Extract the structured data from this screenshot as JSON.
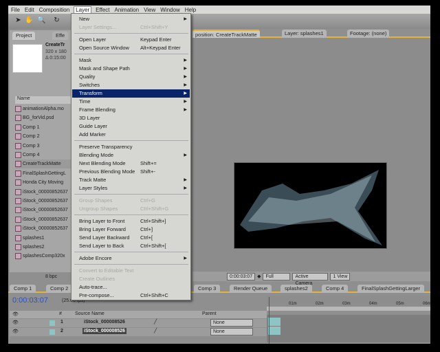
{
  "menubar": [
    "File",
    "Edit",
    "Composition",
    "Layer",
    "Effect",
    "Animation",
    "View",
    "Window",
    "Help"
  ],
  "project": {
    "tab": "Project",
    "tab2": "Effe",
    "comp_name": "CreateTr",
    "comp_size": "320 x 180",
    "comp_duration": "Δ 0:15:00",
    "list_header": "Name",
    "footer_bpc": "8 bpc",
    "items": [
      {
        "name": "animationAlpha.mo"
      },
      {
        "name": "BG_forVid.psd"
      },
      {
        "name": "Comp 1"
      },
      {
        "name": "Comp 2"
      },
      {
        "name": "Comp 3"
      },
      {
        "name": "Comp 4"
      },
      {
        "name": "CreateTrackMatte",
        "selected": true
      },
      {
        "name": "FinalSplashGettingL"
      },
      {
        "name": "Honda City Moving"
      },
      {
        "name": "iStock_00000852637"
      },
      {
        "name": "iStock_00000852637"
      },
      {
        "name": "iStock_00000852637"
      },
      {
        "name": "iStock_00000852637"
      },
      {
        "name": "iStock_00000852637"
      },
      {
        "name": "splashes1"
      },
      {
        "name": "splashes2"
      },
      {
        "name": "splashesComp320x"
      }
    ]
  },
  "layer_menu": [
    {
      "label": "New",
      "submenu": true
    },
    {
      "label": "Layer Settings...",
      "shortcut": "Ctrl+Shift+Y",
      "disabled": true
    },
    {
      "sep": true
    },
    {
      "label": "Open Layer",
      "shortcut": "Keypad Enter"
    },
    {
      "label": "Open Source Window",
      "shortcut": "Alt+Keypad Enter"
    },
    {
      "sep": true
    },
    {
      "label": "Mask",
      "submenu": true
    },
    {
      "label": "Mask and Shape Path",
      "submenu": true
    },
    {
      "label": "Quality",
      "submenu": true
    },
    {
      "label": "Switches",
      "submenu": true
    },
    {
      "label": "Transform",
      "submenu": true,
      "highlighted": true
    },
    {
      "label": "Time",
      "submenu": true
    },
    {
      "label": "Frame Blending",
      "submenu": true
    },
    {
      "label": "3D Layer"
    },
    {
      "label": "Guide Layer"
    },
    {
      "label": "Add Marker"
    },
    {
      "sep": true
    },
    {
      "label": "Preserve Transparency"
    },
    {
      "label": "Blending Mode",
      "submenu": true
    },
    {
      "label": "Next Blending Mode",
      "shortcut": "Shift+="
    },
    {
      "label": "Previous Blending Mode",
      "shortcut": "Shift+-"
    },
    {
      "label": "Track Matte",
      "submenu": true
    },
    {
      "label": "Layer Styles",
      "submenu": true
    },
    {
      "sep": true
    },
    {
      "label": "Group Shapes",
      "shortcut": "Ctrl+G",
      "disabled": true
    },
    {
      "label": "Ungroup Shapes",
      "shortcut": "Ctrl+Shift+G",
      "disabled": true
    },
    {
      "sep": true
    },
    {
      "label": "Bring Layer to Front",
      "shortcut": "Ctrl+Shift+]"
    },
    {
      "label": "Bring Layer Forward",
      "shortcut": "Ctrl+]"
    },
    {
      "label": "Send Layer Backward",
      "shortcut": "Ctrl+["
    },
    {
      "label": "Send Layer to Back",
      "shortcut": "Ctrl+Shift+["
    },
    {
      "sep": true
    },
    {
      "label": "Adobe Encore",
      "submenu": true
    },
    {
      "sep": true
    },
    {
      "label": "Convert to Editable Text",
      "disabled": true
    },
    {
      "label": "Create Outlines",
      "disabled": true
    },
    {
      "label": "Auto-trace..."
    },
    {
      "label": "Pre-compose...",
      "shortcut": "Ctrl+Shift+C"
    }
  ],
  "viewer": {
    "tabs": [
      "position: CreateTrackMatte",
      "Layer: splashes1",
      "Footage: (none)"
    ],
    "timecode": "0:00:03:07",
    "resolution": "Full",
    "camera": "Active Camera",
    "views": "1 View"
  },
  "timeline": {
    "tabs": [
      "Comp 1",
      "Comp 2",
      "Comp 3",
      "Render Queue",
      "splashes2",
      "Comp 4",
      "FinalSplashGettingLarger"
    ],
    "timecode": "0:00:03:07",
    "fps": "(25.00 fps)",
    "columns": {
      "num": "#",
      "source": "Source Name",
      "parent": "Parent"
    },
    "layers": [
      {
        "num": "1",
        "name": "iStock_000008526",
        "parent": "None"
      },
      {
        "num": "2",
        "name": "iStock_000008526",
        "parent": "None"
      }
    ],
    "ruler": [
      "01m",
      "02m",
      "03m",
      "04m",
      "05m",
      "06m"
    ]
  },
  "colors": {
    "menu_highlight": "#0a246a",
    "timecode": "#2a50c8",
    "tab_accent": "#e4b43a"
  }
}
